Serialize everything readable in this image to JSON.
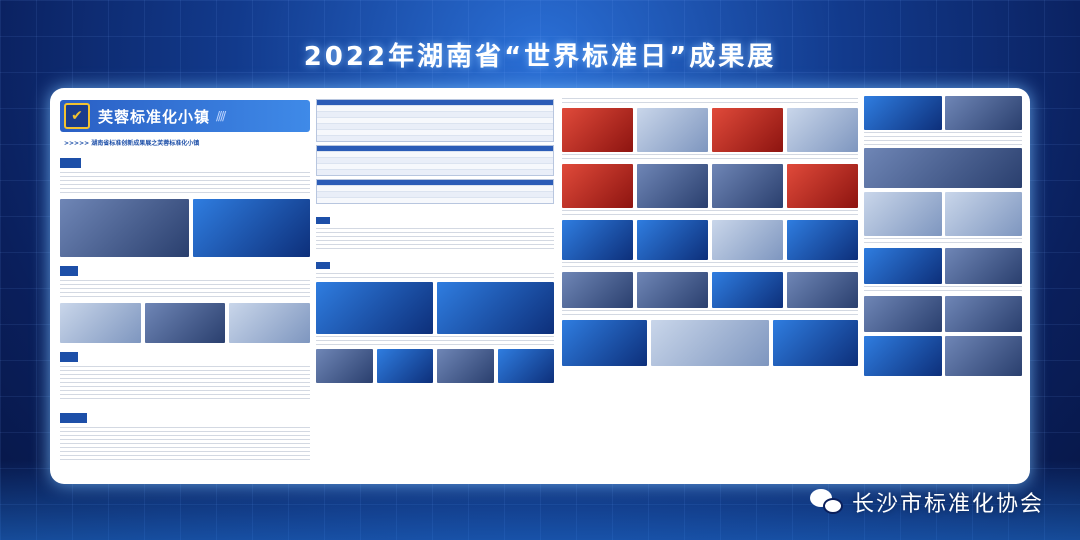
{
  "title": "2022年湖南省“世界标准日”成果展",
  "left_panel": {
    "banner_title": "芙蓉标准化小镇",
    "subtitle": ">>>>> 湖南省标准创新成果展之芙蓉标准化小镇",
    "badge_icon": "shield-icon"
  },
  "watermark": {
    "text": "长沙市标准化协会",
    "icon": "wechat-icon"
  },
  "colors": {
    "primary": "#1d4fa8",
    "accent": "#f2c230"
  }
}
